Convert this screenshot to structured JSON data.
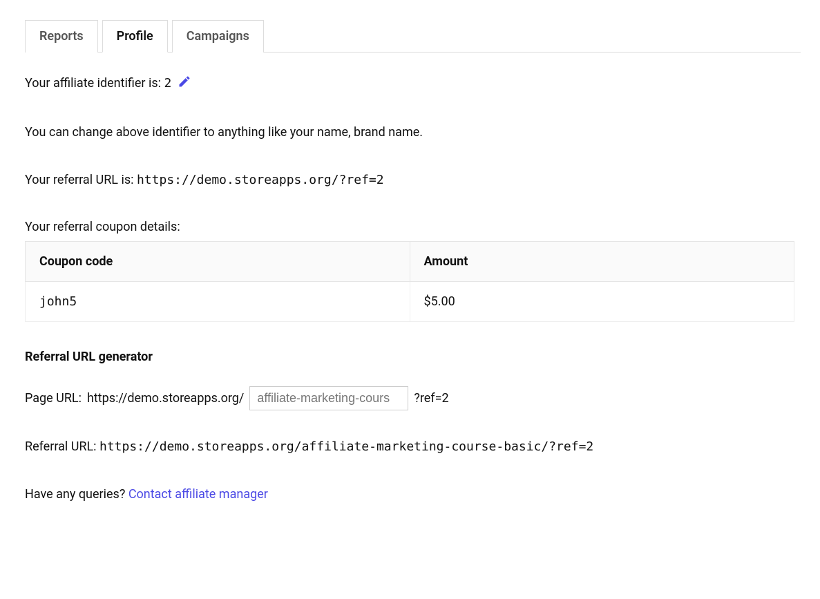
{
  "tabs": {
    "reports": "Reports",
    "profile": "Profile",
    "campaigns": "Campaigns"
  },
  "identifier": {
    "label": "Your affiliate identifier is:",
    "value": "2"
  },
  "change_hint": "You can change above identifier to anything like your name, brand name.",
  "referral_url": {
    "label": "Your referral URL is:",
    "value": "https://demo.storeapps.org/?ref=2"
  },
  "coupon": {
    "label": "Your referral coupon details:",
    "headers": {
      "code": "Coupon code",
      "amount": "Amount"
    },
    "rows": [
      {
        "code": "john5",
        "amount": "$5.00"
      }
    ]
  },
  "generator": {
    "title": "Referral URL generator",
    "page_url_label": "Page URL:",
    "base": "https://demo.storeapps.org/",
    "input_value": "affiliate-marketing-cours",
    "placeholder": "affiliate-marketing-cours",
    "suffix": "?ref=2",
    "result_label": "Referral URL:",
    "result_value": "https://demo.storeapps.org/affiliate-marketing-course-basic/?ref=2"
  },
  "queries": {
    "text": "Have any queries?",
    "link": "Contact affiliate manager"
  }
}
